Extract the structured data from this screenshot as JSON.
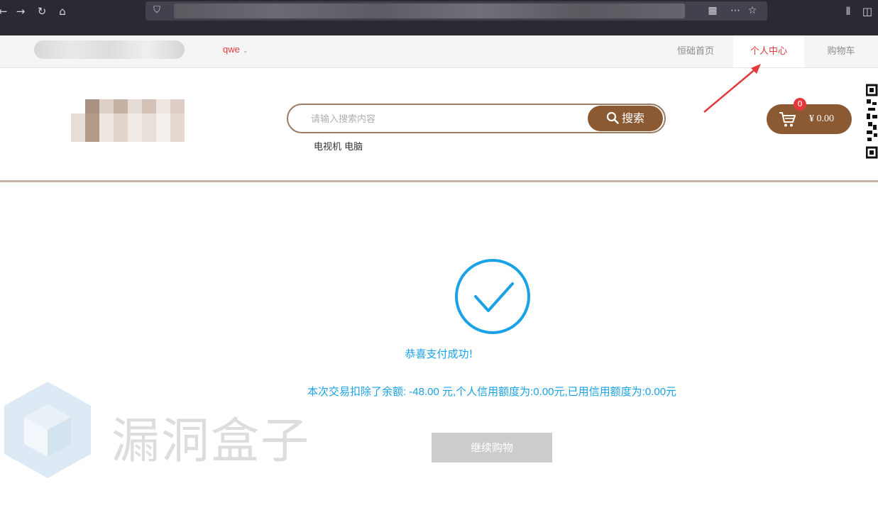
{
  "browser": {
    "back_icon": "back-icon",
    "forward_icon": "forward-icon",
    "reload_icon": "reload-icon",
    "home_icon": "home-icon"
  },
  "topnav": {
    "username": "qwe",
    "links": [
      "恒础首页",
      "个人中心",
      "购物车"
    ]
  },
  "search": {
    "placeholder": "请输入搜索内容",
    "button_label": "搜索",
    "hotwords": "电视机 电脑"
  },
  "cart": {
    "count": "0",
    "amount": "¥ 0.00"
  },
  "result": {
    "title": "恭喜支付成功!",
    "detail": "本次交易扣除了余额: -48.00 元,个人信用额度为:0.00元,已用信用额度为:0.00元",
    "continue_label": "继续购物"
  },
  "watermark": {
    "text": "漏洞盒子"
  },
  "colors": {
    "accent_brown": "#8b5a33",
    "active_red": "#e4393c",
    "success_blue": "#1aa1e6"
  }
}
